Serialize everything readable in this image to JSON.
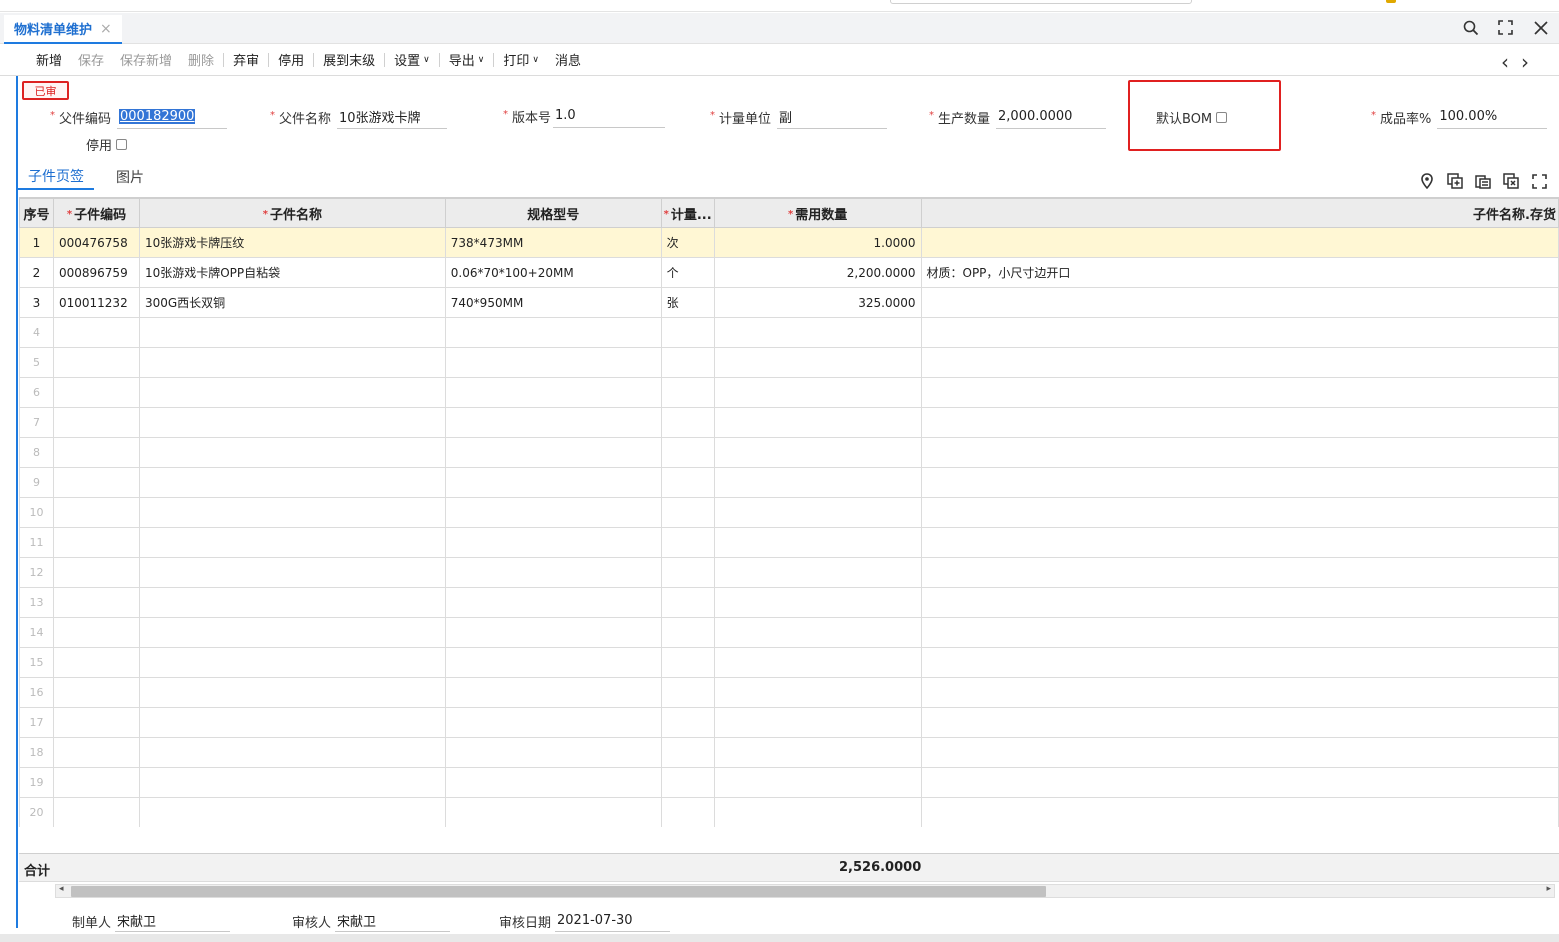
{
  "tab": {
    "label": "物料清单维护",
    "close": "×"
  },
  "toolbar": {
    "new": "新增",
    "save": "保存",
    "save_new": "保存新增",
    "delete": "删除",
    "abandon": "弃审",
    "disable": "停用",
    "expand": "展到末级",
    "settings": "设置",
    "export": "导出",
    "print": "打印",
    "message": "消息"
  },
  "status_stamp": "已审",
  "form": {
    "parent_code_label": "父件编码",
    "parent_code": "000182900",
    "parent_name_label": "父件名称",
    "parent_name": "10张游戏卡牌",
    "version_label": "版本号",
    "version": "1.0",
    "unit_label": "计量单位",
    "unit": "副",
    "qty_label": "生产数量",
    "qty": "2,000.0000",
    "default_bom_label": "默认BOM",
    "yield_label": "成品率%",
    "yield": "100.00%",
    "disabled_label": "停用"
  },
  "subtabs": {
    "children": "子件页签",
    "images": "图片"
  },
  "grid": {
    "columns": {
      "idx": "序号",
      "code": "子件编码",
      "name": "子件名称",
      "spec": "规格型号",
      "unit": "计量...",
      "qty": "需用数量",
      "extra": "子件名称.存货"
    },
    "rows": [
      {
        "idx": "1",
        "code": "000476758",
        "name": "10张游戏卡牌压纹",
        "spec": "738*473MM",
        "unit": "次",
        "qty": "1.0000",
        "extra": ""
      },
      {
        "idx": "2",
        "code": "000896759",
        "name": "10张游戏卡牌OPP自粘袋",
        "spec": "0.06*70*100+20MM",
        "unit": "个",
        "qty": "2,200.0000",
        "extra": "材质：OPP，小尺寸边开口"
      },
      {
        "idx": "3",
        "code": "010011232",
        "name": "300G西长双铜",
        "spec": "740*950MM",
        "unit": "张",
        "qty": "325.0000",
        "extra": ""
      },
      {
        "idx": "4"
      },
      {
        "idx": "5"
      },
      {
        "idx": "6"
      },
      {
        "idx": "7"
      },
      {
        "idx": "8"
      },
      {
        "idx": "9"
      },
      {
        "idx": "10"
      },
      {
        "idx": "11"
      },
      {
        "idx": "12"
      },
      {
        "idx": "13"
      },
      {
        "idx": "14"
      },
      {
        "idx": "15"
      },
      {
        "idx": "16"
      },
      {
        "idx": "17"
      },
      {
        "idx": "18"
      },
      {
        "idx": "19"
      },
      {
        "idx": "20"
      }
    ]
  },
  "total": {
    "label": "合计",
    "value": "2,526.0000"
  },
  "footer": {
    "maker_label": "制单人",
    "maker": "宋献卫",
    "auditor_label": "审核人",
    "auditor": "宋献卫",
    "audit_date_label": "审核日期",
    "audit_date": "2021-07-30"
  },
  "colors": {
    "accent": "#1e7be0",
    "stamp": "#dd2222",
    "selected_row": "#fff7d4"
  },
  "icons": [
    "search-icon",
    "maximize-icon",
    "close-icon",
    "prev-icon",
    "next-icon",
    "location-icon",
    "add-row-icon",
    "copy-row-icon",
    "delete-row-icon",
    "fullscreen-icon"
  ]
}
